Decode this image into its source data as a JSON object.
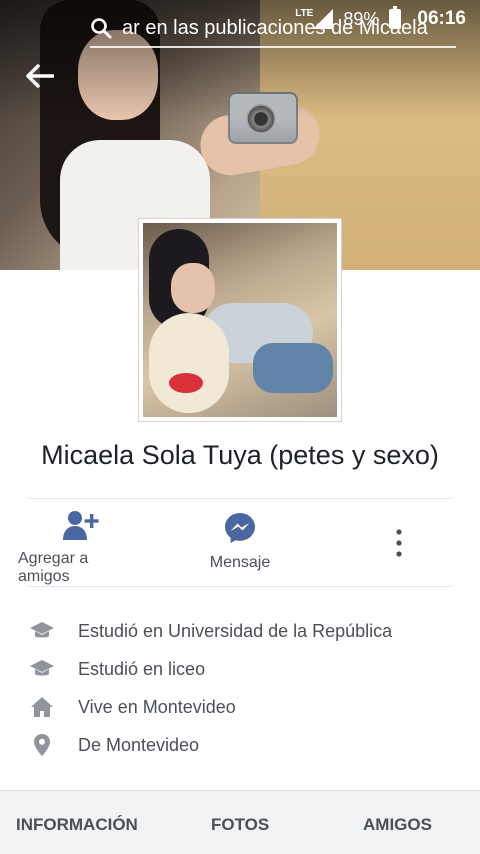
{
  "status_bar": {
    "network": "LTE",
    "battery": "89%",
    "time": "06:16"
  },
  "top_bar": {
    "search_text": "ar en las publicaciones de Micaela"
  },
  "profile": {
    "name": "Micaela Sola Tuya (petes y sexo)"
  },
  "actions": {
    "add_friend": "Agregar a amigos",
    "message": "Mensaje"
  },
  "info": [
    {
      "icon": "graduation-cap-icon",
      "text": "Estudió en Universidad de la República"
    },
    {
      "icon": "graduation-cap-icon",
      "text": "Estudió en liceo"
    },
    {
      "icon": "home-icon",
      "text": "Vive en Montevideo"
    },
    {
      "icon": "location-pin-icon",
      "text": "De Montevideo"
    }
  ],
  "tabs": [
    "INFORMACIÓN",
    "FOTOS",
    "AMIGOS"
  ],
  "colors": {
    "icon_gray": "#90949c",
    "action_blue": "#4b67a1",
    "text_dark": "#1d2129",
    "text_muted": "#4b4f56"
  }
}
